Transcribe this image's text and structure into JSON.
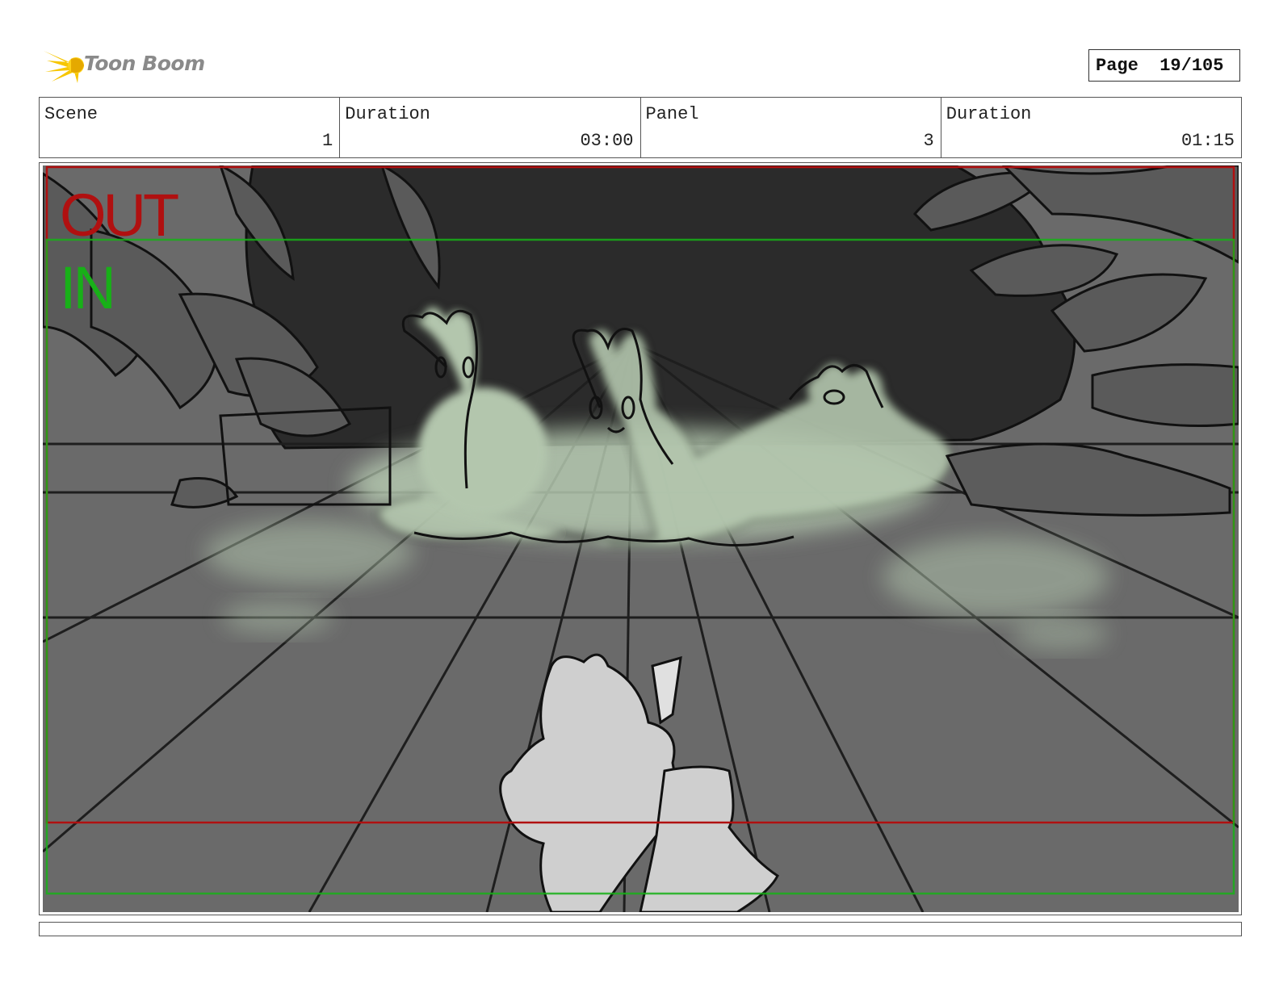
{
  "brand": {
    "name": "Toon Boom",
    "logo_icon": "starburst-logo-icon",
    "accent": "#f5c400"
  },
  "page": {
    "label": "Page",
    "value": "19/105"
  },
  "info": {
    "scene_label": "Scene",
    "scene_value": "1",
    "scene_duration_label": "Duration",
    "scene_duration_value": "03:00",
    "panel_label": "Panel",
    "panel_value": "3",
    "panel_duration_label": "Duration",
    "panel_duration_value": "01:15"
  },
  "panel": {
    "out_label": "OUT",
    "in_label": "IN",
    "out_frame_color": "#b01010",
    "in_frame_color": "#18b018"
  }
}
